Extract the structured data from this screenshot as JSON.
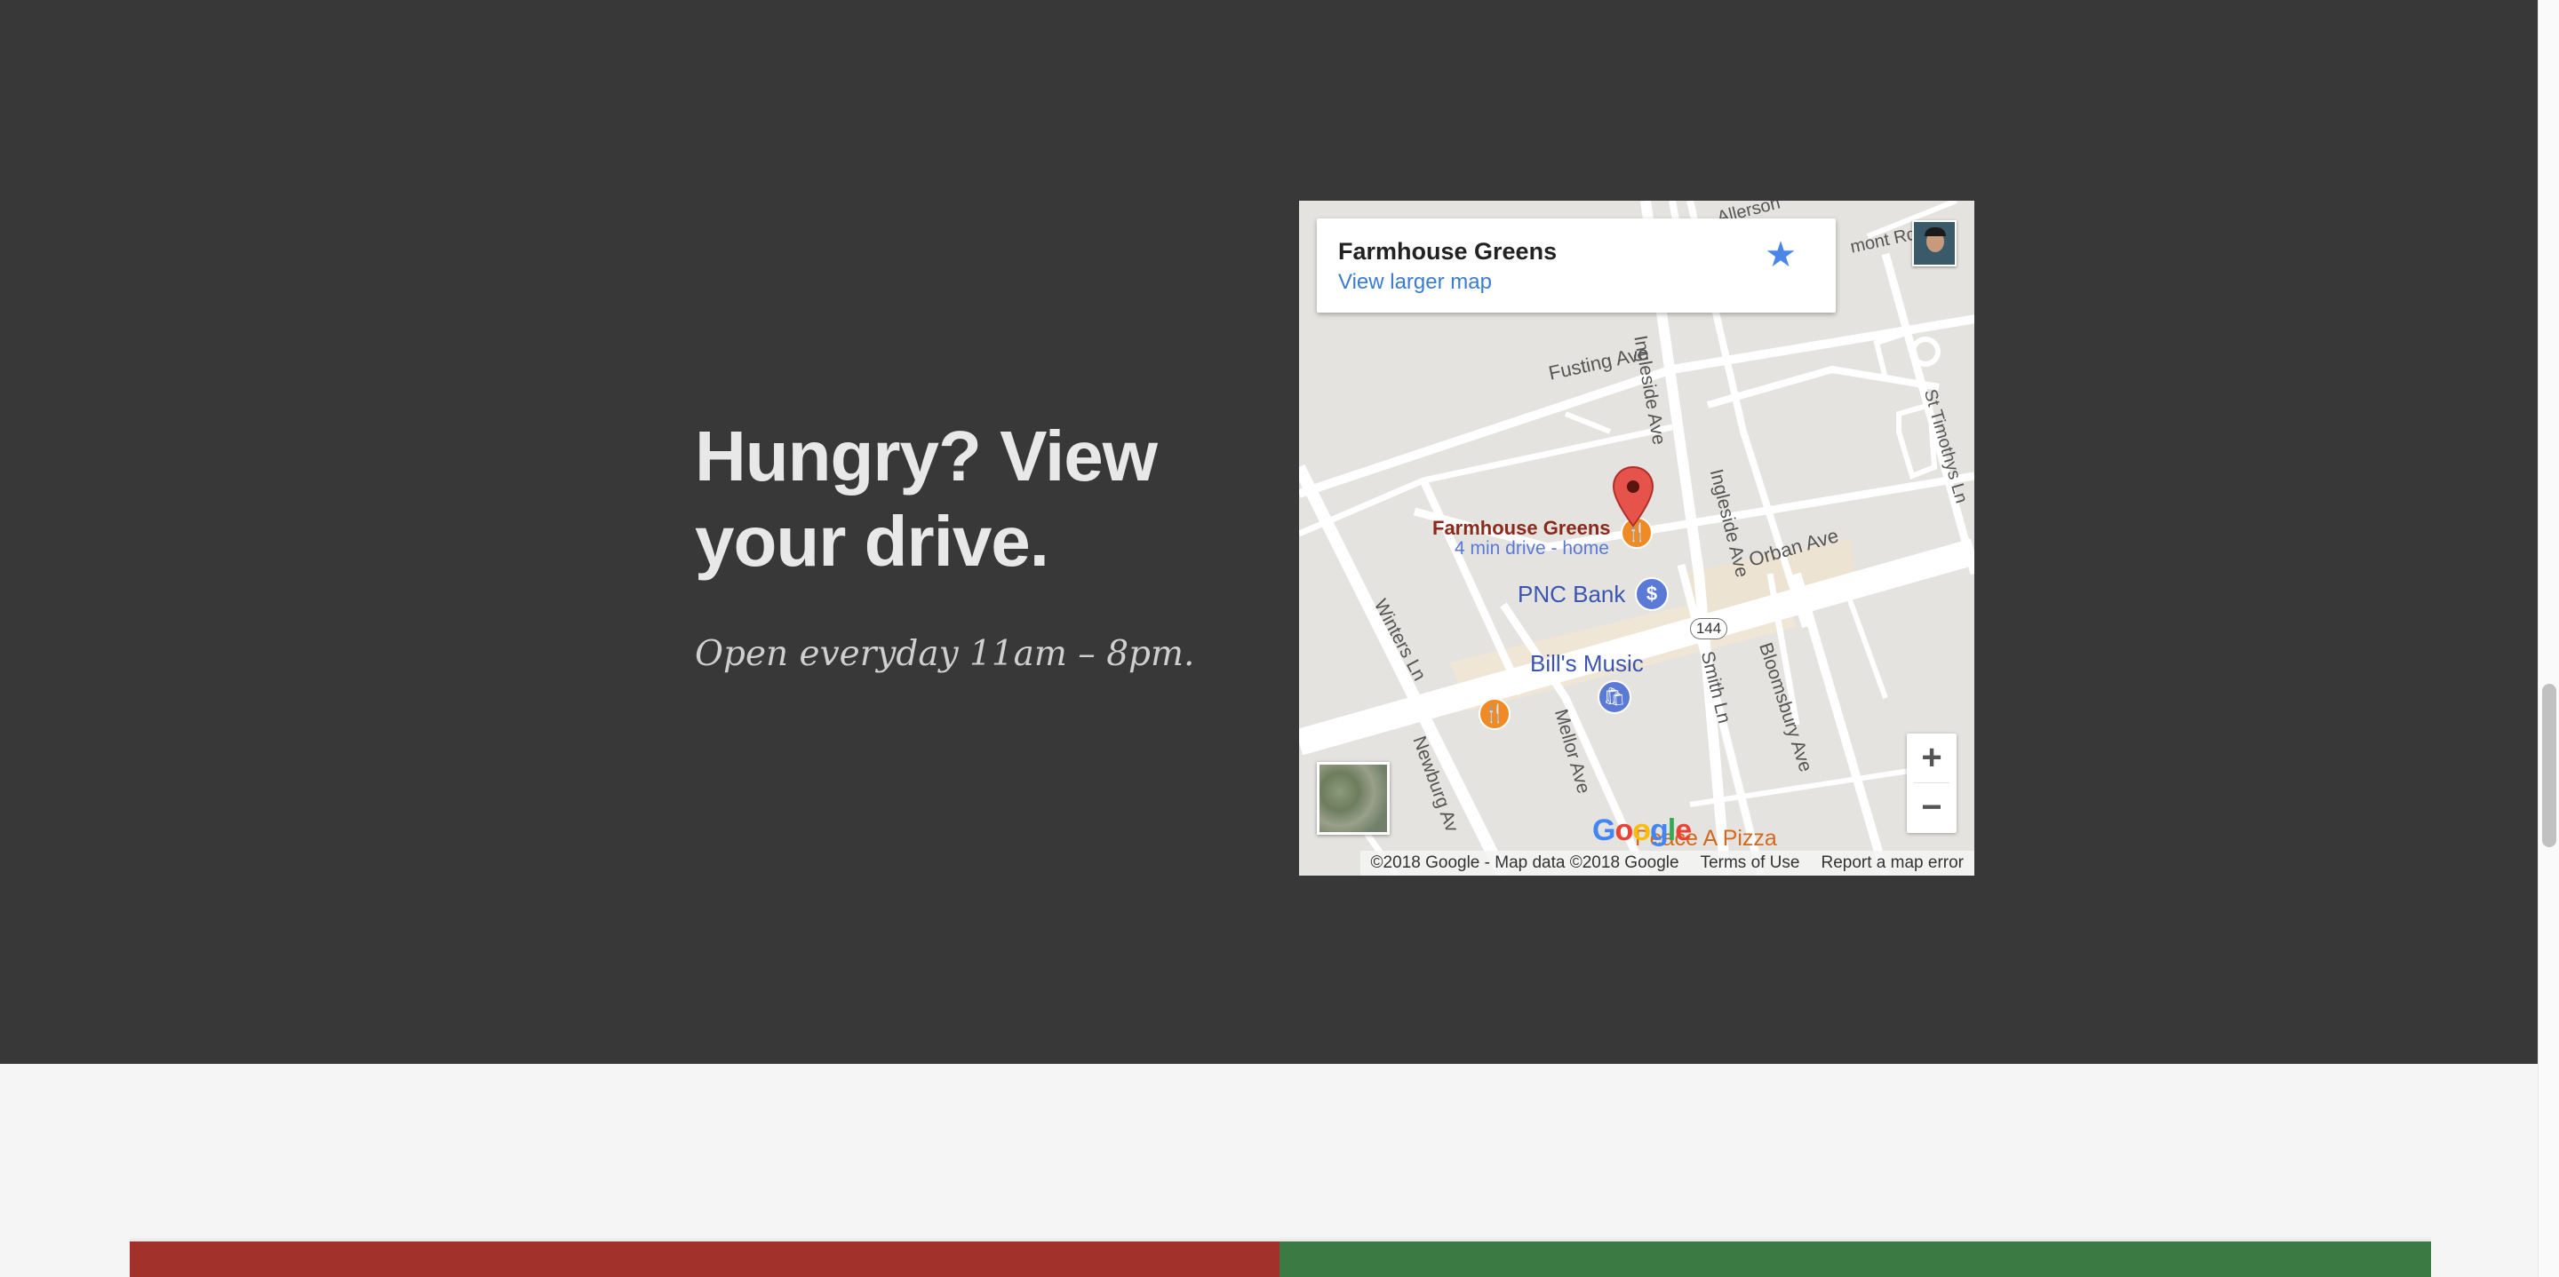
{
  "hero": {
    "heading_line1": "Hungry? View",
    "heading_line2": "your drive.",
    "hours": "Open everyday 11am – 8pm."
  },
  "map": {
    "card": {
      "title": "Farmhouse Greens",
      "link": "View larger map",
      "star_icon": "star-icon"
    },
    "labels": {
      "streets": {
        "fusting": "Fusting Ave",
        "ingleside_top": "Ingleside Ave",
        "ingleside": "Ingleside Ave",
        "orban": "Orban Ave",
        "winters": "Winters Ln",
        "mellor": "Mellor Ave",
        "smith": "Smith Ln",
        "bloomsbury": "Bloomsbury Ave",
        "newburg": "Newburg Av",
        "st_timothys": "St Timothys Ln",
        "allerson": "Allerson",
        "mont": "mont Rd",
        "route": "144"
      },
      "places": {
        "farmhouse": "Farmhouse Greens",
        "farmhouse_drive": "4 min drive - home",
        "pnc": "PNC Bank",
        "bills": "Bill's Music",
        "pizza": "Peace A Pizza"
      }
    },
    "google_logo": "Google",
    "zoom_in": "+",
    "zoom_out": "−",
    "attribution": {
      "copyright": "©2018 Google - Map data ©2018 Google",
      "terms": "Terms of Use",
      "report": "Report a map error"
    },
    "colors": {
      "marker": "#e5534b",
      "restaurant": "#f08a24",
      "poi_blue": "#5b7ad6"
    }
  },
  "footer_bars": {
    "left_color": "#a2302b",
    "right_color": "#3b7a42"
  }
}
